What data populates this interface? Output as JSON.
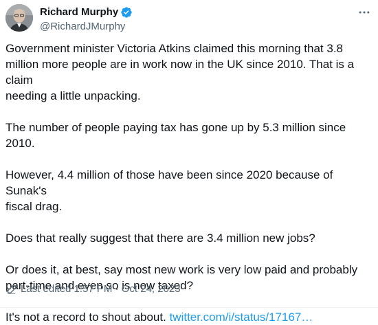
{
  "author": {
    "display_name": "Richard Murphy",
    "handle": "@RichardJMurphy",
    "verified": true,
    "verified_color": "#1d9bf0",
    "avatar_icon": "profile-photo"
  },
  "menu": {
    "icon": "more-horizontal-icon"
  },
  "tweet": {
    "paragraphs": [
      "Government minister Victoria Atkins claimed this morning that 3.8\nmillion more people are in work now in the UK since 2010. That is a claim\nneeding a little unpacking.",
      "The number of people paying tax has gone up by 5.3 million since 2010.",
      "However, 4.4 million of those have been since 2020 because of Sunak's\nfiscal drag.",
      "Does that really suggest that there are 3.4 million new jobs?",
      "Or does it, at best, say most new work is very low paid and probably\npart-time and even so is now taxed?"
    ],
    "last_text": "It's not a record to shout about. ",
    "link_text": "twitter.com/i/status/17167…",
    "link_color": "#1d9bf0"
  },
  "edit_info": {
    "icon": "pencil-icon",
    "label": "Last edited 1:57 PM · Oct 24, 2023"
  }
}
